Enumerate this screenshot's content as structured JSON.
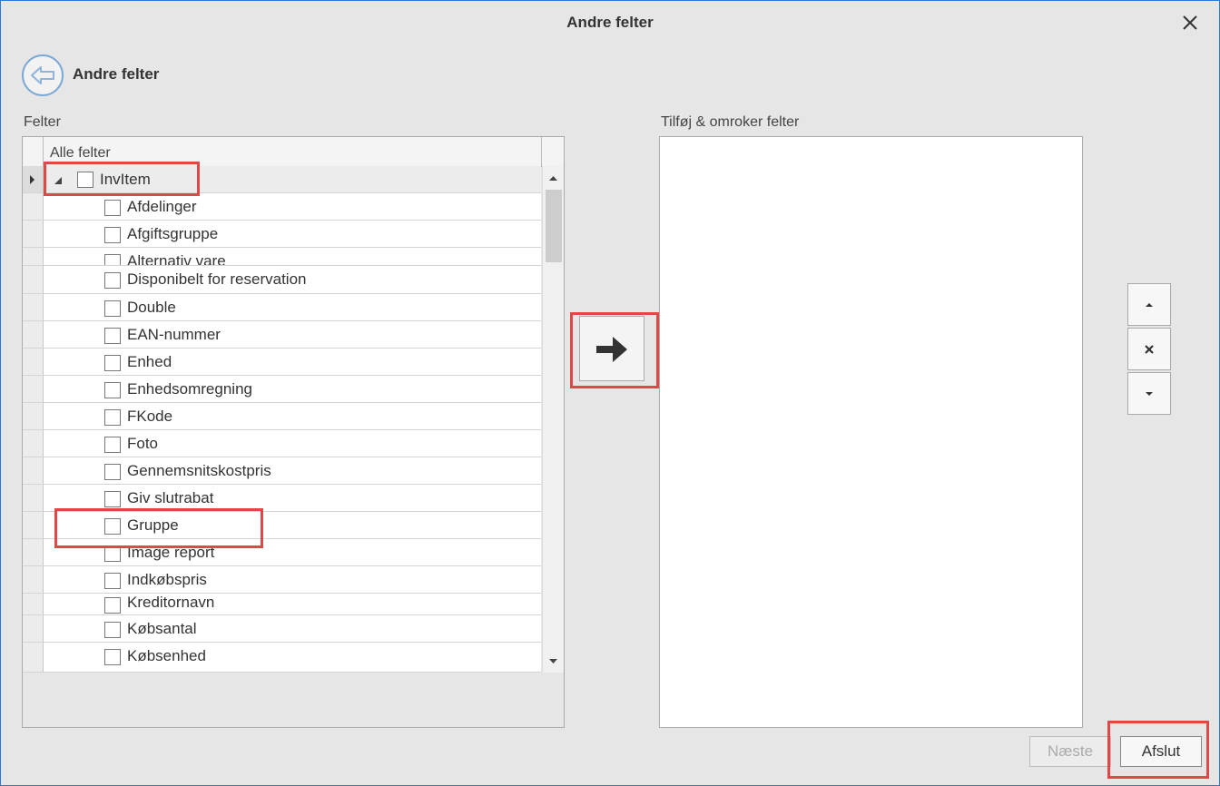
{
  "window": {
    "title": "Andre felter"
  },
  "page": {
    "heading": "Andre felter"
  },
  "left": {
    "label": "Felter",
    "column_header": "Alle felter",
    "parent": "InvItem",
    "items": [
      "Afdelinger",
      "Afgiftsgruppe",
      "Alternativ vare",
      "Disponibelt for reservation",
      "Double",
      "EAN-nummer",
      "Enhed",
      "Enhedsomregning",
      "FKode",
      "Foto",
      "Gennemsnitskostpris",
      "Giv slutrabat",
      "Gruppe",
      "Image report",
      "Indkøbspris",
      "Kreditornavn",
      "Købsantal",
      "Købsenhed"
    ]
  },
  "right": {
    "label": "Tilføj & omroker felter"
  },
  "buttons": {
    "next": "Næste",
    "finish": "Afslut"
  },
  "icons": {
    "close": "close-icon",
    "back": "back-arrow-icon",
    "move": "arrow-right-icon",
    "up": "caret-up-icon",
    "remove": "x-icon",
    "down": "caret-down-icon"
  },
  "colors": {
    "highlight": "#e04848",
    "accent": "#2b79d6"
  }
}
